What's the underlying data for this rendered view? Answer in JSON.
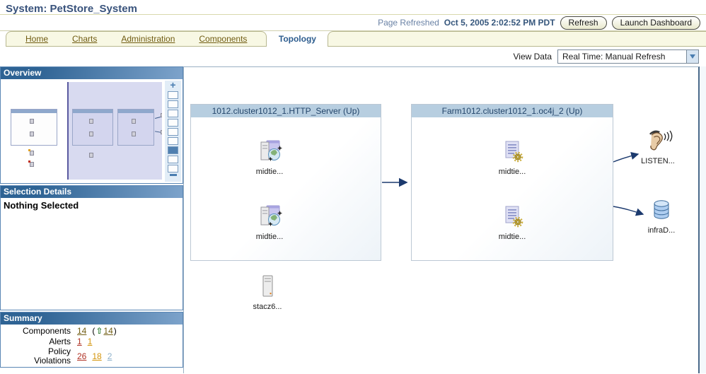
{
  "header": {
    "title": "System: PetStore_System",
    "page_refreshed_label": "Page Refreshed",
    "page_refreshed_value": "Oct 5, 2005 2:02:52 PM PDT",
    "refresh_button": "Refresh",
    "launch_dashboard_button": "Launch Dashboard"
  },
  "tabs": {
    "items": [
      {
        "label": "Home"
      },
      {
        "label": "Charts"
      },
      {
        "label": "Administration"
      },
      {
        "label": "Components"
      }
    ],
    "active": "Topology"
  },
  "view_data": {
    "label": "View Data",
    "selected": "Real Time: Manual Refresh"
  },
  "sidebar": {
    "overview": {
      "title": "Overview",
      "zoom_in": "+",
      "zoom_levels": 9,
      "active_zoom_index": 7
    },
    "selection_details": {
      "title": "Selection Details",
      "content": "Nothing Selected"
    },
    "summary": {
      "title": "Summary",
      "components_label": "Components",
      "components_total": "14",
      "components_paren_open": "(",
      "components_up_arrow": "⇧",
      "components_up_count": "14",
      "components_paren_close": ")",
      "alerts_label": "Alerts",
      "alerts_critical": "1",
      "alerts_warning": "1",
      "policy_label_line1": "Policy",
      "policy_label_line2": "Violations",
      "policy_critical": "26",
      "policy_warning": "18",
      "policy_info": "2"
    }
  },
  "topology": {
    "clusters": [
      {
        "title": "1012.cluster1012_1.HTTP_Server (Up)",
        "nodes": [
          {
            "label": "midtie...",
            "icon": "http-server-icon"
          },
          {
            "label": "midtie...",
            "icon": "http-server-icon"
          }
        ]
      },
      {
        "title": "Farm1012.cluster1012_1.oc4j_2 (Up)",
        "nodes": [
          {
            "label": "midtie...",
            "icon": "oc4j-icon"
          },
          {
            "label": "midtie...",
            "icon": "oc4j-icon"
          }
        ]
      }
    ],
    "standalone_nodes": [
      {
        "label": "LISTEN...",
        "icon": "listener-icon"
      },
      {
        "label": "infraD...",
        "icon": "database-icon"
      },
      {
        "label": "stacz6...",
        "icon": "host-icon"
      }
    ]
  },
  "colors": {
    "accent_blue": "#2e6394",
    "cluster_title_bg": "#b7cee0",
    "tab_bg": "#f8f8e4",
    "link_olive": "#705c12",
    "critical_red": "#b03326",
    "warning_orange": "#d4950c",
    "info_blue": "#8fb2cc",
    "up_green": "#2e7d32",
    "edge_navy": "#1c3a6e"
  }
}
